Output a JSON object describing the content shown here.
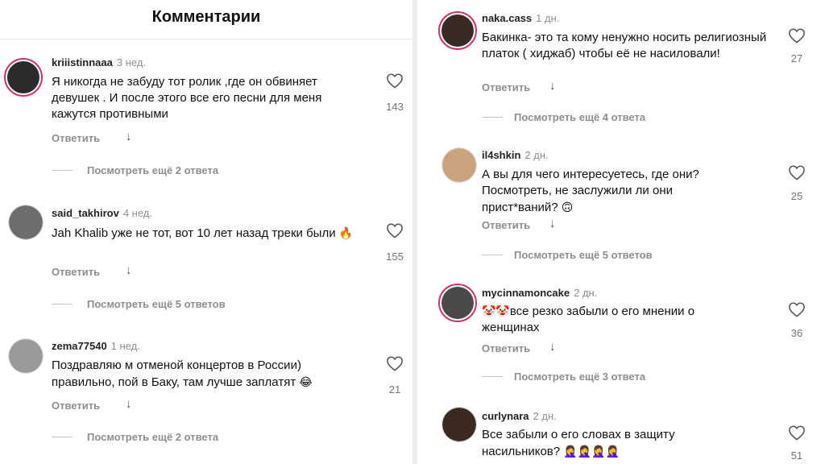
{
  "left_panel": {
    "title": "Комментарии",
    "comments": [
      {
        "user": "kriiistinnaaa",
        "time": "3 нед.",
        "text": "Я никогда не забуду тот ролик ,где он обвиняет девушек . И после этого все его песни для меня кажутся противными",
        "likes": "143",
        "reply": "Ответить",
        "more": "Посмотреть ещё 2 ответа",
        "avatar_color": "#2b2b2b",
        "ring": true
      },
      {
        "user": "said_takhirov",
        "time": "4 нед.",
        "text": "Jah Khalib уже не тот, вот 10 лет назад треки были",
        "emoji": "🔥",
        "likes": "155",
        "reply": "Ответить",
        "more": "Посмотреть ещё 5 ответов",
        "avatar_color": "#6d6d6d",
        "ring": false
      },
      {
        "user": "zema77540",
        "time": "1 нед.",
        "text": "Поздравляю м отменой концертов в России) правильно, пой в Баку, там лучше заплатят",
        "emoji": "😂",
        "likes": "21",
        "reply": "Ответить",
        "more": "Посмотреть ещё 2 ответа",
        "avatar_color": "#9a9a9a",
        "ring": false
      }
    ]
  },
  "right_panel": {
    "comments": [
      {
        "user": "naka.cass",
        "time": "1 дн.",
        "text": "Бакинка- это та кому ненужно носить религиозный платок ( хиджаб) чтобы её не насиловали!",
        "likes": "27",
        "reply": "Ответить",
        "more": "Посмотреть ещё 4 ответа",
        "avatar_color": "#3a2a24",
        "ring": true
      },
      {
        "user": "il4shkin",
        "time": "2 дн.",
        "text": "А вы для чего интересуетесь, где они? Посмотреть, не заслужили ли они прист*ваний?",
        "emoji": "🙃",
        "likes": "25",
        "reply": "Ответить",
        "more": "Посмотреть ещё 5 ответов",
        "avatar_color": "#c9a27e",
        "ring": false
      },
      {
        "user": "mycinnamoncake",
        "time": "2 дн.",
        "emoji_prefix": "🤡🤡",
        "text": "все резко забыли о его мнении о женщинах",
        "likes": "36",
        "reply": "Ответить",
        "more": "Посмотреть ещё 3 ответа",
        "avatar_color": "#4a4a4a",
        "ring": true
      },
      {
        "user": "curlynara",
        "time": "2 дн.",
        "text": "Все забыли о его словах в защиту насильников?",
        "emoji": "🤦‍♀️🤦‍♀️🤦‍♀️🤦‍♀️",
        "likes": "51",
        "reply": "Ответить",
        "avatar_color": "#3b2a22",
        "ring": false
      }
    ]
  },
  "icons": {
    "like": "heart-outline-icon",
    "reply_arrow": "arrow-down-icon"
  },
  "colors": {
    "ring": "#d6336c",
    "muted": "#8e8e8e"
  }
}
